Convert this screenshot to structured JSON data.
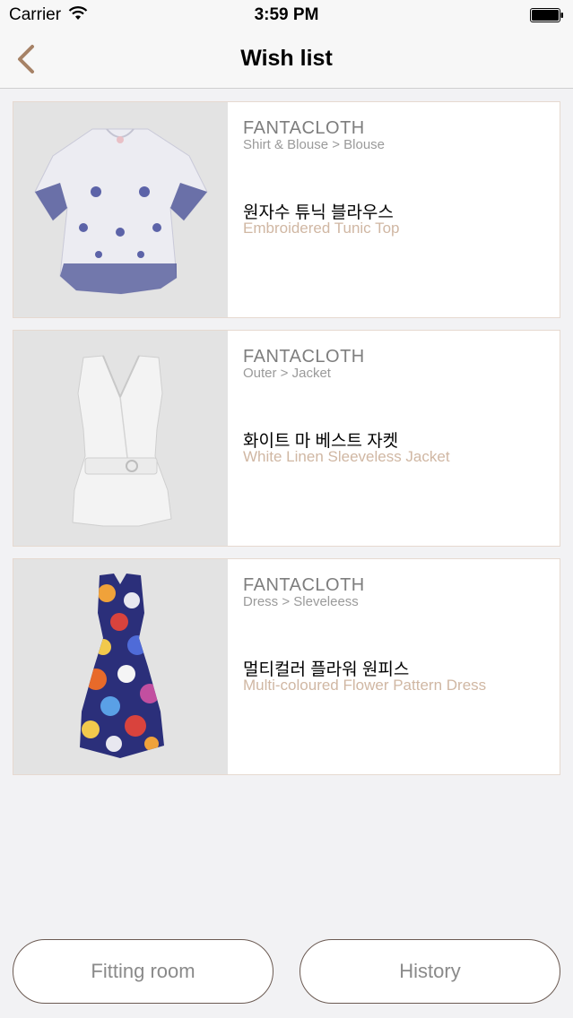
{
  "status_bar": {
    "carrier": "Carrier",
    "time": "3:59 PM",
    "wifi_icon": "wifi-icon",
    "battery_icon": "battery-icon"
  },
  "nav": {
    "title": "Wish list",
    "back_icon": "chevron-left-icon",
    "accent_color": "#a68266"
  },
  "items": [
    {
      "brand": "FANTACLOTH",
      "category": "Shirt & Blouse > Blouse",
      "name_ko": "원자수 튜닉 블라우스",
      "name_en": "Embroidered Tunic Top",
      "image": "blouse-image"
    },
    {
      "brand": "FANTACLOTH",
      "category": "Outer > Jacket",
      "name_ko": "화이트 마 베스트 자켓",
      "name_en": "White Linen Sleeveless Jacket",
      "image": "jacket-image"
    },
    {
      "brand": "FANTACLOTH",
      "category": "Dress > Sleveleess",
      "name_ko": "멀티컬러 플라워 원피스",
      "name_en": "Multi-coloured Flower Pattern Dress",
      "image": "dress-image"
    }
  ],
  "buttons": {
    "fitting_room": "Fitting room",
    "history": "History"
  },
  "colors": {
    "subtitle_tan": "#d0b7a3",
    "card_border": "#e6d9d0",
    "button_border": "#6b5a52"
  }
}
